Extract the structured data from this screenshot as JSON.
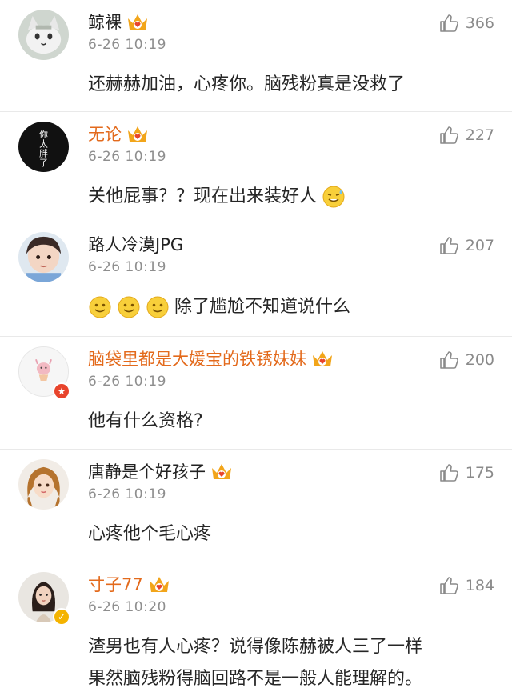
{
  "comments": [
    {
      "name": "鲸裸",
      "time": "6-26 10:19",
      "likes": "366",
      "text": "还赫赫加油，心疼你。脑残粉真是没救了",
      "name_color": "black",
      "avatar_icon": "cat-avatar-icon"
    },
    {
      "name": "无论",
      "time": "6-26 10:19",
      "likes": "227",
      "text": "关他屁事？？现在出来装好人",
      "name_color": "orange",
      "avatar_icon": "calligraphy-avatar-icon",
      "avatar_text": "你太胖了",
      "trailing_emoji": "sweat-smile-emoji-icon"
    },
    {
      "name": "路人冷漠JPG",
      "time": "6-26 10:19",
      "likes": "207",
      "text": "除了尴尬不知道说什么",
      "name_color": "black",
      "avatar_icon": "child-photo-avatar-icon",
      "leading_emojis": [
        "smile-emoji-icon",
        "smile-emoji-icon",
        "smile-emoji-icon"
      ]
    },
    {
      "name": "脑袋里都是大媛宝的铁锈妹妹",
      "time": "6-26 10:19",
      "likes": "200",
      "text": "他有什么资格?",
      "name_color": "orange",
      "avatar_icon": "cartoon-avatar-icon",
      "badge": "red-verified-badge"
    },
    {
      "name": "唐静是个好孩子",
      "time": "6-26 10:19",
      "likes": "175",
      "text": "心疼他个毛心疼",
      "name_color": "black",
      "avatar_icon": "girl-illustration-avatar-icon"
    },
    {
      "name": "寸子77",
      "time": "6-26 10:20",
      "likes": "184",
      "lines": [
        "渣男也有人心疼？说得像陈赫被人三了一样",
        "果然脑残粉得脑回路不是一般人能理解的。"
      ],
      "name_color": "orange",
      "avatar_icon": "woman-photo-avatar-icon",
      "badge": "gold-verified-badge"
    }
  ],
  "colors": {
    "orange_name": "#e36a1c",
    "time": "#8e8e8e",
    "divider": "#e9e9e9",
    "crown": "#f2a51a"
  }
}
